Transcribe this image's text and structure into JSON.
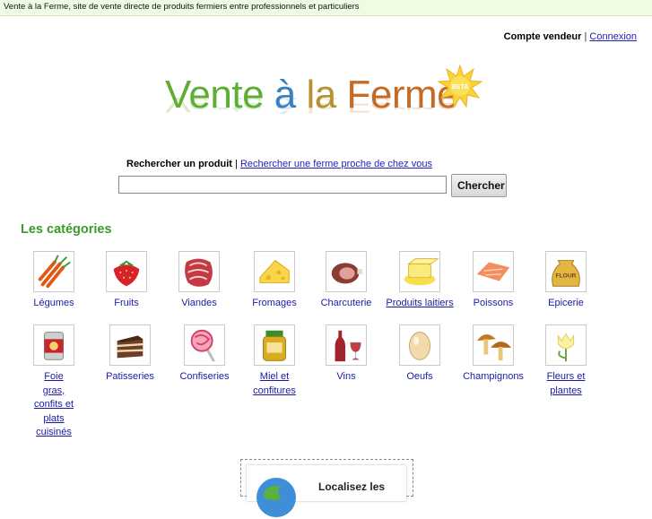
{
  "topbar": {
    "text": "Vente à la Ferme, site de vente directe de produits fermiers entre professionnels et particuliers"
  },
  "account": {
    "seller": "Compte vendeur",
    "separator": "|",
    "login": "Connexion"
  },
  "logo": {
    "words": [
      "Vente",
      "à",
      "la",
      "Ferme"
    ],
    "badge": "BETA"
  },
  "search": {
    "product_label": "Rechercher un produit",
    "separator": "|",
    "farm_link": "Rechercher une ferme proche de chez vous",
    "input_value": "",
    "button": "Chercher"
  },
  "categories_title": "Les catégories",
  "categories": [
    {
      "icon": "carrots-icon",
      "label": "Légumes"
    },
    {
      "icon": "strawberry-icon",
      "label": "Fruits"
    },
    {
      "icon": "meat-icon",
      "label": "Viandes"
    },
    {
      "icon": "cheese-icon",
      "label": "Fromages"
    },
    {
      "icon": "ham-icon",
      "label": "Charcuterie"
    },
    {
      "icon": "butter-icon",
      "label": "Produits laitiers"
    },
    {
      "icon": "salmon-icon",
      "label": "Poissons"
    },
    {
      "icon": "flour-sack-icon",
      "label": "Epicerie"
    },
    {
      "icon": "tin-can-icon",
      "label": "Foie gras, confits et plats cuisinés"
    },
    {
      "icon": "cake-icon",
      "label": "Patisseries"
    },
    {
      "icon": "lollipop-icon",
      "label": "Confiseries"
    },
    {
      "icon": "honey-jar-icon",
      "label": "Miel et confitures"
    },
    {
      "icon": "wine-icon",
      "label": "Vins"
    },
    {
      "icon": "egg-icon",
      "label": "Oeufs"
    },
    {
      "icon": "mushrooms-icon",
      "label": "Champignons"
    },
    {
      "icon": "tulip-icon",
      "label": "Fleurs et plantes"
    }
  ],
  "map_box": {
    "text": "Localisez les"
  },
  "colors": {
    "green_title": "#3a9a2a",
    "link": "#1a1aaa",
    "topbar_bg": "#f0fbe3"
  }
}
